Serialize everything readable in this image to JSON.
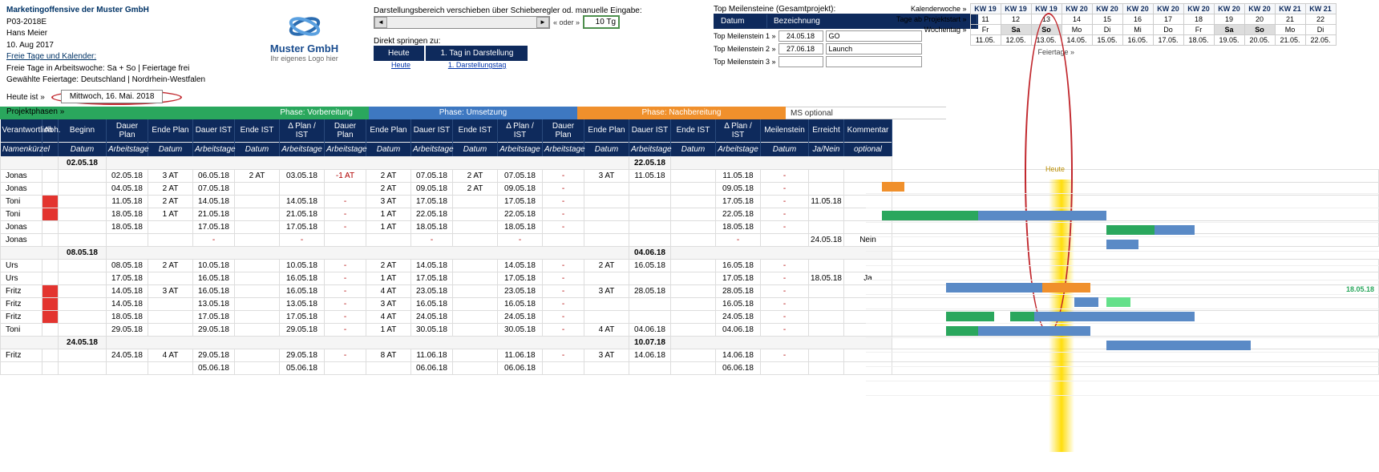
{
  "meta": {
    "title": "Marketingoffensive der Muster GmbH",
    "code": "P03-2018E",
    "author": "Hans Meier",
    "date": "10. Aug 2017",
    "link_days": "Freie Tage und Kalender:",
    "days_text": "Freie Tage in Arbeitswoche: Sa + So | Feiertage frei",
    "holiday_text": "Gewählte Feiertage: Deutschland | Nordrhein-Westfalen"
  },
  "logo": {
    "name": "Muster GmbH",
    "sub": "Ihr eigenes Logo hier"
  },
  "scroll": {
    "label": "Darstellungsbereich verschieben über Schieberegler od. manuelle Eingabe:",
    "oder": "« oder »",
    "tg": "10 Tg",
    "jump": "Direkt springen zu:",
    "btn1": "Heute",
    "btn2": "1. Tag in Darstellung",
    "lnk1": "Heute",
    "lnk2": "1. Darstellungstag"
  },
  "milestones": {
    "title": "Top Meilensteine (Gesamtprojekt):",
    "h1": "Datum",
    "h2": "Bezeichnung",
    "r1l": "Top Meilenstein 1 »",
    "r1d": "24.05.18",
    "r1t": "GO",
    "r2l": "Top Meilenstein 2 »",
    "r2d": "27.06.18",
    "r2t": "Launch",
    "r3l": "Top Meilenstein 3 »",
    "r3d": "",
    "r3t": ""
  },
  "feier": "Feiertage »",
  "calhdr": {
    "kw_lbl": "Kalenderwoche »",
    "tps_lbl": "Tage ab Projektstart »",
    "wd_lbl": "Wochentag »",
    "kw": [
      "KW 19",
      "KW 19",
      "KW 19",
      "KW 20",
      "KW 20",
      "KW 20",
      "KW 20",
      "KW 20",
      "KW 20",
      "KW 20",
      "KW 21",
      "KW 21"
    ],
    "tps": [
      "11",
      "12",
      "13",
      "14",
      "15",
      "16",
      "17",
      "18",
      "19",
      "20",
      "21",
      "22"
    ],
    "wd": [
      "Fr",
      "Sa",
      "So",
      "Mo",
      "Di",
      "Mi",
      "Do",
      "Fr",
      "Sa",
      "So",
      "Mo",
      "Di"
    ],
    "dt": [
      "11.05.",
      "12.05.",
      "13.05.",
      "14.05.",
      "15.05.",
      "16.05.",
      "17.05.",
      "18.05.",
      "19.05.",
      "20.05.",
      "21.05.",
      "22.05."
    ]
  },
  "today": {
    "lbl": "Heute ist »",
    "val": "Mittwoch, 16. Mai. 2018"
  },
  "phases": {
    "lbl": "Projektphasen »",
    "p1": "Phase: Vorbereitung",
    "p2": "Phase: Umsetzung",
    "p3": "Phase: Nachbereitung",
    "ms": "MS optional"
  },
  "cols": [
    "Verantwortlich",
    "Abh.",
    "Beginn",
    "Dauer Plan",
    "Ende Plan",
    "Dauer IST",
    "Ende IST",
    "Δ Plan / IST",
    "Dauer Plan",
    "Ende Plan",
    "Dauer IST",
    "Ende IST",
    "Δ Plan / IST",
    "Dauer Plan",
    "Ende Plan",
    "Dauer IST",
    "Ende IST",
    "Δ Plan / IST",
    "Meilenstein",
    "Erreicht",
    "Kommentar"
  ],
  "subcols": [
    "Namenkürzel",
    "",
    "Datum",
    "Arbeitstage",
    "Datum",
    "Arbeitstage",
    "Datum",
    "Arbeitstage",
    "Arbeitstage",
    "Datum",
    "Arbeitstage",
    "Datum",
    "Arbeitstage",
    "Arbeitstage",
    "Datum",
    "Arbeitstage",
    "Datum",
    "Arbeitstage",
    "Datum",
    "Ja/Nein",
    "optional"
  ],
  "groups": [
    {
      "start": "02.05.18",
      "end": "22.05.18",
      "rows": [
        {
          "n": "Jonas",
          "r": 0,
          "c": [
            "",
            "02.05.18",
            "3 AT",
            "06.05.18",
            "2 AT",
            "03.05.18",
            "-1 AT",
            "2 AT",
            "07.05.18",
            "2 AT",
            "07.05.18",
            "-",
            "3 AT",
            "11.05.18",
            "",
            "11.05.18",
            "-",
            "",
            "",
            ""
          ]
        },
        {
          "n": "Jonas",
          "r": 0,
          "c": [
            "",
            "04.05.18",
            "2 AT",
            "07.05.18",
            "",
            "",
            "",
            "2 AT",
            "09.05.18",
            "2 AT",
            "09.05.18",
            "-",
            "",
            "",
            "",
            "09.05.18",
            "-",
            "",
            "",
            ""
          ]
        },
        {
          "n": "Toni",
          "r": 1,
          "c": [
            "",
            "11.05.18",
            "2 AT",
            "14.05.18",
            "",
            "14.05.18",
            "-",
            "3 AT",
            "17.05.18",
            "",
            "17.05.18",
            "-",
            "",
            "",
            "",
            "17.05.18",
            "-",
            "11.05.18",
            "",
            ""
          ]
        },
        {
          "n": "Toni",
          "r": 1,
          "c": [
            "",
            "18.05.18",
            "1 AT",
            "21.05.18",
            "",
            "21.05.18",
            "-",
            "1 AT",
            "22.05.18",
            "",
            "22.05.18",
            "-",
            "",
            "",
            "",
            "22.05.18",
            "-",
            "",
            "",
            ""
          ]
        },
        {
          "n": "Jonas",
          "r": 0,
          "c": [
            "",
            "18.05.18",
            "",
            "17.05.18",
            "",
            "17.05.18",
            "-",
            "1 AT",
            "18.05.18",
            "",
            "18.05.18",
            "-",
            "",
            "",
            "",
            "18.05.18",
            "-",
            "",
            "",
            ""
          ]
        },
        {
          "n": "Jonas",
          "r": 0,
          "c": [
            "",
            "",
            "",
            "-",
            "",
            "-",
            "",
            "",
            "-",
            "",
            "-",
            "",
            "",
            "",
            "",
            "-",
            "",
            "24.05.18",
            "Nein",
            ""
          ]
        }
      ]
    },
    {
      "start": "08.05.18",
      "end": "04.06.18",
      "rows": [
        {
          "n": "Urs",
          "r": 0,
          "c": [
            "",
            "08.05.18",
            "2 AT",
            "10.05.18",
            "",
            "10.05.18",
            "-",
            "2 AT",
            "14.05.18",
            "",
            "14.05.18",
            "-",
            "2 AT",
            "16.05.18",
            "",
            "16.05.18",
            "-",
            "",
            "",
            ""
          ]
        },
        {
          "n": "Urs",
          "r": 0,
          "c": [
            "",
            "17.05.18",
            "",
            "16.05.18",
            "",
            "16.05.18",
            "-",
            "1 AT",
            "17.05.18",
            "",
            "17.05.18",
            "-",
            "",
            "",
            "",
            "17.05.18",
            "-",
            "18.05.18",
            "Ja",
            ""
          ]
        },
        {
          "n": "Fritz",
          "r": 1,
          "c": [
            "",
            "14.05.18",
            "3 AT",
            "16.05.18",
            "",
            "16.05.18",
            "-",
            "4 AT",
            "23.05.18",
            "",
            "23.05.18",
            "-",
            "3 AT",
            "28.05.18",
            "",
            "28.05.18",
            "-",
            "",
            "",
            ""
          ]
        },
        {
          "n": "Fritz",
          "r": 1,
          "c": [
            "",
            "14.05.18",
            "",
            "13.05.18",
            "",
            "13.05.18",
            "-",
            "3 AT",
            "16.05.18",
            "",
            "16.05.18",
            "-",
            "",
            "",
            "",
            "16.05.18",
            "-",
            "",
            "",
            ""
          ]
        },
        {
          "n": "Fritz",
          "r": 1,
          "c": [
            "",
            "18.05.18",
            "",
            "17.05.18",
            "",
            "17.05.18",
            "-",
            "4 AT",
            "24.05.18",
            "",
            "24.05.18",
            "-",
            "",
            "",
            "",
            "24.05.18",
            "-",
            "",
            "",
            ""
          ]
        },
        {
          "n": "Toni",
          "r": 0,
          "c": [
            "",
            "29.05.18",
            "",
            "29.05.18",
            "",
            "29.05.18",
            "-",
            "1 AT",
            "30.05.18",
            "",
            "30.05.18",
            "-",
            "4 AT",
            "04.06.18",
            "",
            "04.06.18",
            "-",
            "",
            "",
            ""
          ]
        }
      ]
    },
    {
      "start": "24.05.18",
      "end": "10.07.18",
      "rows": [
        {
          "n": "Fritz",
          "r": 0,
          "c": [
            "",
            "24.05.18",
            "4 AT",
            "29.05.18",
            "",
            "29.05.18",
            "-",
            "8 AT",
            "11.06.18",
            "",
            "11.06.18",
            "-",
            "3 AT",
            "14.06.18",
            "",
            "14.06.18",
            "-",
            "",
            "",
            ""
          ]
        },
        {
          "n": "",
          "r": 0,
          "c": [
            "",
            "",
            "",
            "05.06.18",
            "",
            "05.06.18",
            "",
            "",
            "06.06.18",
            "",
            "06.06.18",
            "",
            "",
            "",
            "",
            "06.06.18",
            "",
            "",
            "",
            ""
          ]
        }
      ]
    }
  ],
  "heute_g": "Heute",
  "ms_text": "18.05.18"
}
